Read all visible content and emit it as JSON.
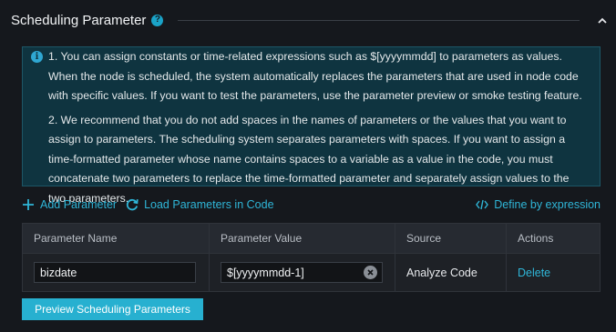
{
  "header": {
    "title": "Scheduling Parameter",
    "help_glyph": "?"
  },
  "info": {
    "icon_glyph": "i",
    "paragraph1": "1. You can assign constants or time-related expressions such as $[yyyymmdd] to parameters as values. When the node is scheduled, the system automatically replaces the parameters that are used in node code with specific values. If you want to test the parameters, use the parameter preview or smoke testing feature.",
    "paragraph2": "2. We recommend that you do not add spaces in the names of parameters or the values that you want to assign to parameters. The scheduling system separates parameters with spaces. If you want to assign a time-formatted parameter whose name contains spaces to a variable as a value in the code, you must concatenate two parameters to replace the time-formatted parameter and separately assign values to the two parameters."
  },
  "toolbar": {
    "add_label": "Add Parameter",
    "load_label": "Load Parameters in Code",
    "define_label": "Define by expression"
  },
  "table": {
    "columns": [
      "Parameter Name",
      "Parameter Value",
      "Source",
      "Actions"
    ],
    "rows": [
      {
        "name": "bizdate",
        "value": "$[yyyymmdd-1]",
        "source": "Analyze Code",
        "action": "Delete"
      }
    ]
  },
  "preview_button": "Preview Scheduling Parameters",
  "colors": {
    "accent": "#27b0d0",
    "link": "#2fb6d8",
    "info_bg": "#0f3440",
    "page_bg": "#15181d"
  }
}
